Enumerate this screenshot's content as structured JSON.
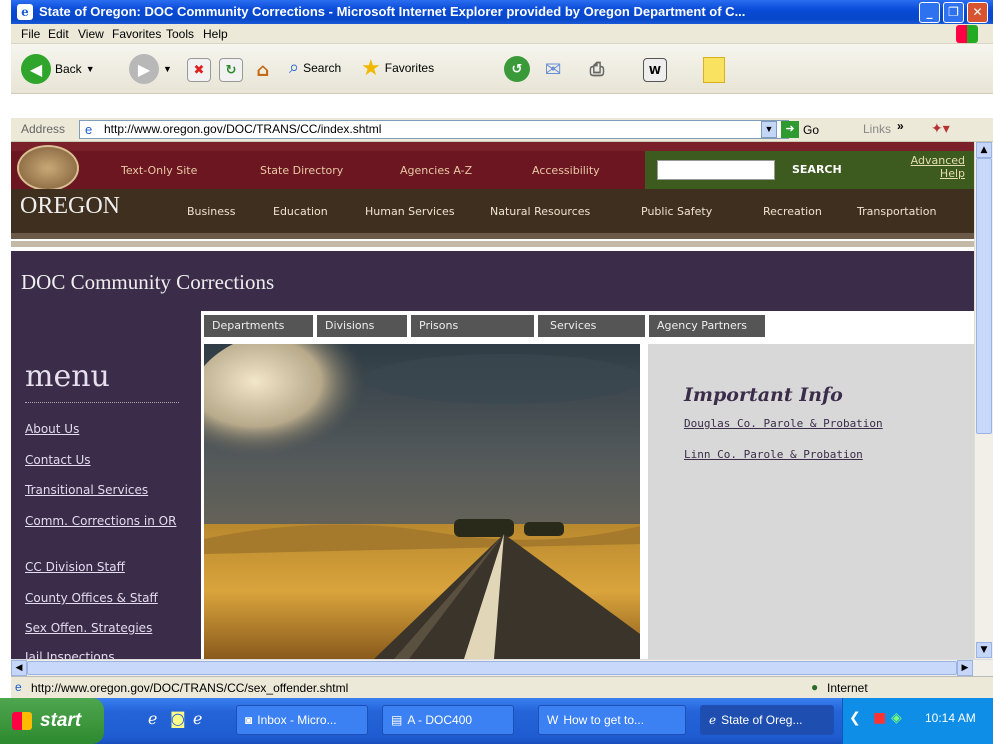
{
  "window": {
    "title": "State of Oregon: DOC Community Corrections - Microsoft Internet Explorer provided by Oregon Department of C..."
  },
  "menubar": [
    "File",
    "Edit",
    "View",
    "Favorites",
    "Tools",
    "Help"
  ],
  "toolbar": {
    "back": "Back",
    "search": "Search",
    "favorites": "Favorites"
  },
  "address": {
    "label": "Address",
    "url": "http://www.oregon.gov/DOC/TRANS/CC/index.shtml",
    "go": "Go",
    "links": "Links"
  },
  "site": {
    "top_links": [
      "Text-Only Site",
      "State Directory",
      "Agencies A-Z",
      "Accessibility"
    ],
    "search_button": "SEARCH",
    "advanced_help": [
      "Advanced",
      "Help"
    ],
    "brand": "OREGON",
    "nav": [
      "Business",
      "Education",
      "Human Services",
      "Natural Resources",
      "Public Safety",
      "Recreation",
      "Transportation"
    ],
    "page_heading": "DOC Community Corrections",
    "tabs": [
      "Departments",
      "Divisions",
      "Prisons",
      "Services",
      "Agency Partners"
    ],
    "menu_title": "menu",
    "menu_items": [
      "About Us",
      "Contact Us",
      "Transitional Services",
      "Comm. Corrections in OR",
      "CC Division Staff",
      "County Offices & Staff",
      "Sex Offen. Strategies",
      "Jail Inspections"
    ],
    "info_title": "Important Info",
    "info_links": [
      "Douglas Co. Parole & Probation",
      "Linn Co. Parole & Probation"
    ]
  },
  "status": {
    "url": "http://www.oregon.gov/DOC/TRANS/CC/sex_offender.shtml",
    "zone": "Internet"
  },
  "taskbar": {
    "start": "start",
    "items": [
      "Inbox - Micro...",
      "A - DOC400",
      "How to get to...",
      "State of Oreg..."
    ],
    "clock": "10:14 AM"
  },
  "colors": {
    "title_bar": "#0a4bd8",
    "top_strip": "#6b1620",
    "nav_strip": "#3f2f1e",
    "content_purple": "#3b2c49",
    "search_area": "#3d5b1f",
    "info_link": "#3b2c49"
  }
}
